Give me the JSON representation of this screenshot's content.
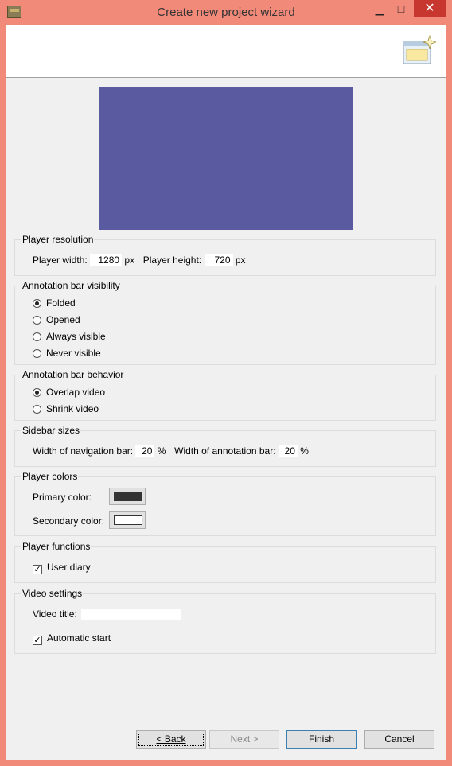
{
  "window": {
    "title": "Create new project wizard",
    "minimize": "▁",
    "maximize": "□",
    "close": "✕"
  },
  "preview": {
    "background": "#5a5aa0"
  },
  "player_resolution": {
    "legend": "Player resolution",
    "width_label": "Player width:",
    "width_value": "1280",
    "width_unit": "px",
    "height_label": "Player height:",
    "height_value": "720",
    "height_unit": "px"
  },
  "annotation_visibility": {
    "legend": "Annotation bar visibility",
    "options": [
      "Folded",
      "Opened",
      "Always visible",
      "Never visible"
    ],
    "selected": "Folded"
  },
  "annotation_behavior": {
    "legend": "Annotation bar behavior",
    "options": [
      "Overlap video",
      "Shrink video"
    ],
    "selected": "Overlap video"
  },
  "sidebar_sizes": {
    "legend": "Sidebar sizes",
    "nav_label": "Width of navigation bar:",
    "nav_value": "20",
    "nav_unit": "%",
    "annot_label": "Width of annotation bar:",
    "annot_value": "20",
    "annot_unit": "%"
  },
  "player_colors": {
    "legend": "Player colors",
    "primary_label": "Primary color:",
    "primary_color": "#333333",
    "secondary_label": "Secondary color:",
    "secondary_color": "#ffffff"
  },
  "player_functions": {
    "legend": "Player functions",
    "user_diary_label": "User diary",
    "user_diary_checked": true
  },
  "video_settings": {
    "legend": "Video settings",
    "title_label": "Video title:",
    "title_value": "",
    "autostart_label": "Automatic start",
    "autostart_checked": true
  },
  "buttons": {
    "back": "< Back",
    "next": "Next >",
    "finish": "Finish",
    "cancel": "Cancel"
  }
}
